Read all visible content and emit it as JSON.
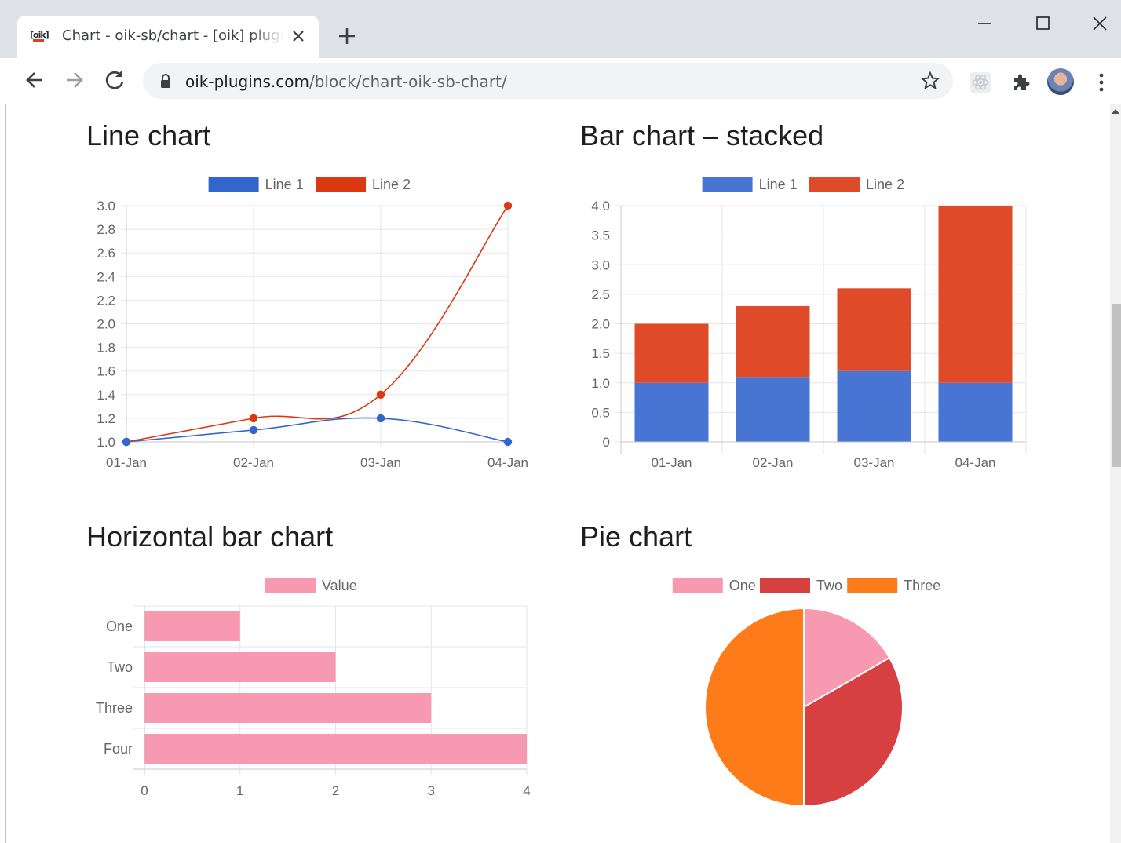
{
  "browser": {
    "tab": {
      "favicon_text": "[oik]",
      "title": "Chart - oik-sb/chart - [oik] plugins"
    },
    "url_domain": "oik-plugins.com",
    "url_path": "/block/chart-oik-sb-chart/"
  },
  "colors": {
    "line1": "#3366cc",
    "line2": "#dc3912",
    "pink": "#f7a3b8",
    "red": "#d84343",
    "orange": "#ff7a1a"
  },
  "icons": [
    "back-icon",
    "forward-icon",
    "reload-icon",
    "lock-icon",
    "star-icon",
    "react-devtools-icon",
    "extensions-icon",
    "kebab-menu-icon",
    "minimize-icon",
    "maximize-icon",
    "close-window-icon",
    "tab-close-icon",
    "new-tab-icon"
  ],
  "sections": {
    "line": {
      "heading": "Line chart"
    },
    "stacked": {
      "heading": "Bar chart – stacked"
    },
    "hbar": {
      "heading": "Horizontal bar chart"
    },
    "pie": {
      "heading": "Pie chart"
    }
  },
  "chart_data": [
    {
      "id": "line",
      "type": "line",
      "title": "Line chart",
      "categories": [
        "01-Jan",
        "02-Jan",
        "03-Jan",
        "04-Jan"
      ],
      "series": [
        {
          "name": "Line 1",
          "values": [
            1.0,
            1.1,
            1.2,
            1.0
          ],
          "color": "#3366cc"
        },
        {
          "name": "Line 2",
          "values": [
            1.0,
            1.2,
            1.4,
            3.0
          ],
          "color": "#dc3912"
        }
      ],
      "ylim": [
        1.0,
        3.0
      ],
      "yticks": [
        "3.0",
        "2.8",
        "2.6",
        "2.4",
        "2.2",
        "2.0",
        "1.8",
        "1.6",
        "1.4",
        "1.2",
        "1.0"
      ],
      "grid": true,
      "legend": "top"
    },
    {
      "id": "stacked",
      "type": "bar",
      "stacked": true,
      "title": "Bar chart – stacked",
      "categories": [
        "01-Jan",
        "02-Jan",
        "03-Jan",
        "04-Jan"
      ],
      "series": [
        {
          "name": "Line 1",
          "values": [
            1.0,
            1.1,
            1.2,
            1.0
          ],
          "color": "#4875d4"
        },
        {
          "name": "Line 2",
          "values": [
            1.0,
            1.2,
            1.4,
            3.0
          ],
          "color": "#df4a28"
        }
      ],
      "ylim": [
        0,
        4.0
      ],
      "yticks": [
        "4.0",
        "3.5",
        "3.0",
        "2.5",
        "2.0",
        "1.5",
        "1.0",
        "0.5",
        "0"
      ],
      "grid": true,
      "legend": "top"
    },
    {
      "id": "hbar",
      "type": "bar",
      "orientation": "horizontal",
      "title": "Horizontal bar chart",
      "categories": [
        "One",
        "Two",
        "Three",
        "Four"
      ],
      "series": [
        {
          "name": "Value",
          "values": [
            1,
            2,
            3,
            4
          ],
          "color": "#f799b1"
        }
      ],
      "xlim": [
        0,
        4
      ],
      "xticks": [
        "0",
        "1",
        "2",
        "3",
        "4"
      ],
      "grid": true,
      "legend": "top"
    },
    {
      "id": "pie",
      "type": "pie",
      "title": "Pie chart",
      "categories": [
        "One",
        "Two",
        "Three"
      ],
      "values": [
        1,
        2,
        3
      ],
      "colors": [
        "#f799b1",
        "#d64040",
        "#fe7b19"
      ],
      "legend": "top"
    }
  ]
}
